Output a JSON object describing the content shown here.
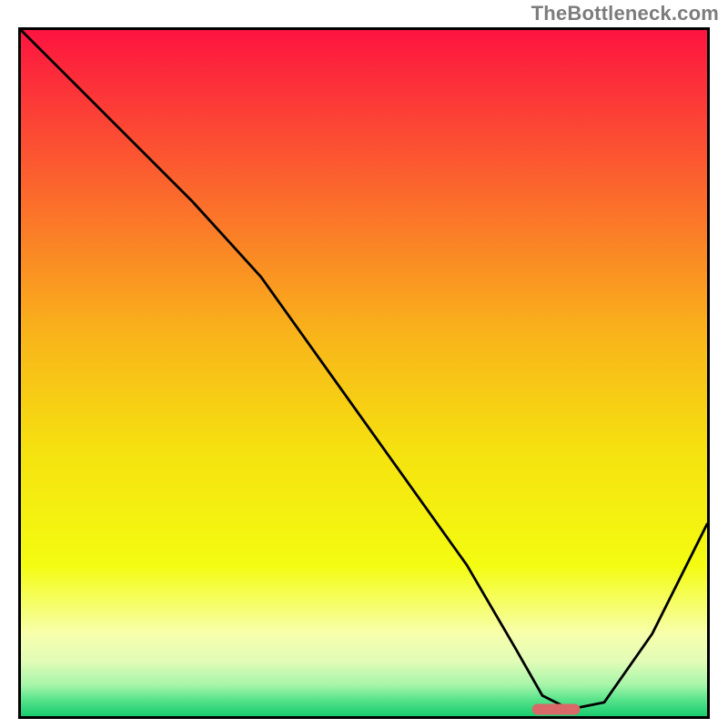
{
  "watermark": "TheBottleneck.com",
  "chart_data": {
    "type": "line",
    "title": "",
    "xlabel": "",
    "ylabel": "",
    "xlim": [
      0,
      100
    ],
    "ylim": [
      0,
      100
    ],
    "grid": false,
    "legend": false,
    "background_gradient": {
      "stops": [
        {
          "offset": 0.0,
          "color": "#fd1440"
        },
        {
          "offset": 0.25,
          "color": "#fb6d2b"
        },
        {
          "offset": 0.45,
          "color": "#f9b61a"
        },
        {
          "offset": 0.62,
          "color": "#f5e30f"
        },
        {
          "offset": 0.78,
          "color": "#f4fc11"
        },
        {
          "offset": 0.88,
          "color": "#f7ffac"
        },
        {
          "offset": 0.92,
          "color": "#e2fcb7"
        },
        {
          "offset": 0.955,
          "color": "#a5f5a9"
        },
        {
          "offset": 0.975,
          "color": "#5be48c"
        },
        {
          "offset": 1.0,
          "color": "#18cd6f"
        }
      ]
    },
    "series": [
      {
        "name": "bottleneck-curve",
        "x": [
          0,
          10,
          25,
          35,
          45,
          55,
          65,
          72,
          76,
          80,
          85,
          92,
          100
        ],
        "y": [
          100,
          90,
          75,
          64,
          50,
          36,
          22,
          10,
          3,
          1,
          2,
          12,
          28
        ]
      }
    ],
    "marker": {
      "name": "target-range",
      "x_center": 78,
      "y": 1,
      "width": 7,
      "color": "#da6868"
    }
  }
}
